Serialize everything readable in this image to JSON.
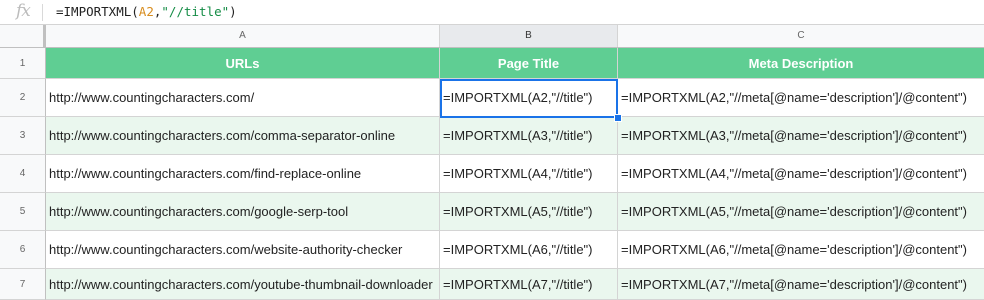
{
  "formula_bar": {
    "icon": "fx-icon",
    "prefix": "=IMPORTXML(",
    "ref": "A2",
    "comma": ",",
    "string": "\"//title\"",
    "suffix": ")"
  },
  "columns": [
    "A",
    "B",
    "C"
  ],
  "header_row": {
    "num": "1",
    "cells": [
      "URLs",
      "Page Title",
      "Meta Description"
    ]
  },
  "rows": [
    {
      "num": "2",
      "cells": [
        "http://www.countingcharacters.com/",
        "=IMPORTXML(A2,\"//title\")",
        "=IMPORTXML(A2,\"//meta[@name='description']/@content\")"
      ]
    },
    {
      "num": "3",
      "cells": [
        "http://www.countingcharacters.com/comma-separator-online",
        "=IMPORTXML(A3,\"//title\")",
        "=IMPORTXML(A3,\"//meta[@name='description']/@content\")"
      ]
    },
    {
      "num": "4",
      "cells": [
        "http://www.countingcharacters.com/find-replace-online",
        "=IMPORTXML(A4,\"//title\")",
        "=IMPORTXML(A4,\"//meta[@name='description']/@content\")"
      ]
    },
    {
      "num": "5",
      "cells": [
        "http://www.countingcharacters.com/google-serp-tool",
        "=IMPORTXML(A5,\"//title\")",
        "=IMPORTXML(A5,\"//meta[@name='description']/@content\")"
      ]
    },
    {
      "num": "6",
      "cells": [
        "http://www.countingcharacters.com/website-authority-checker",
        "=IMPORTXML(A6,\"//title\")",
        "=IMPORTXML(A6,\"//meta[@name='description']/@content\")"
      ]
    },
    {
      "num": "7",
      "cells": [
        "http://www.countingcharacters.com/youtube-thumbnail-downloader",
        "=IMPORTXML(A7,\"//title\")",
        "=IMPORTXML(A7,\"//meta[@name='description']/@content\")"
      ]
    }
  ],
  "colors": {
    "header_green": "#5fce93",
    "alt_row": "#eaf7ee",
    "selection": "#1a73e8"
  }
}
